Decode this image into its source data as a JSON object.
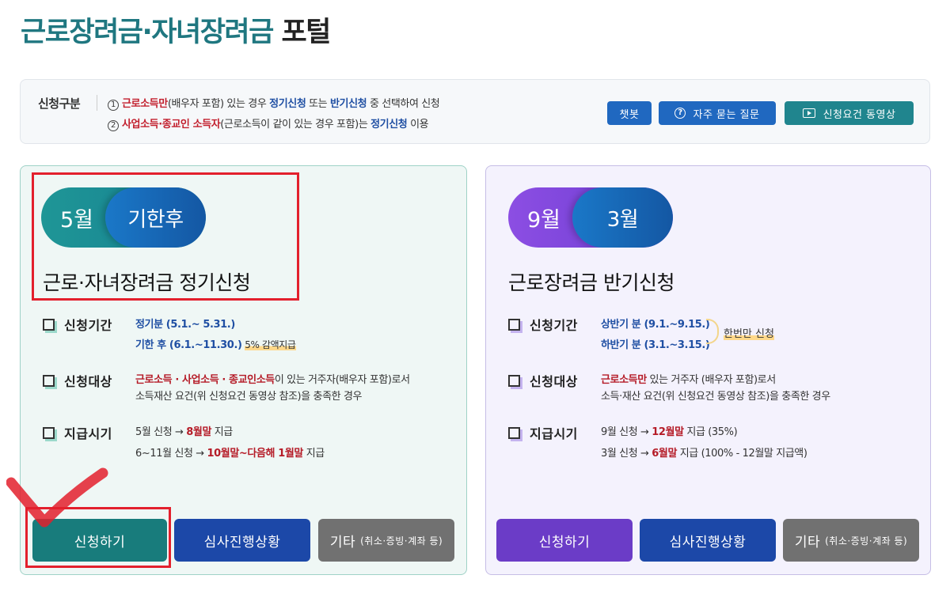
{
  "header": {
    "title_main": "근로장려금·자녀장려금",
    "title_rest": " 포털"
  },
  "info": {
    "label": "신청구분",
    "line1": {
      "num": "1",
      "a": "근로소득만",
      "b": "(배우자 포함) 있는 경우 ",
      "c": "정기신청",
      "d": " 또는 ",
      "e": "반기신청",
      "f": " 중 선택하여 신청"
    },
    "line2": {
      "num": "2",
      "a": "사업소득·종교인 소득자",
      "b": "(근로소득이 같이 있는 경우 포함)는 ",
      "c": "정기신청",
      "d": " 이용"
    },
    "buttons": {
      "chatbot": "챗봇",
      "faq": "자주 묻는 질문",
      "video": "신청요건 동영상"
    }
  },
  "left_card": {
    "pill_a": "5월",
    "pill_b": "기한후",
    "title": "근로·자녀장려금 정기신청",
    "period": {
      "label": "신청기간",
      "l1": "정기분 (5.1.~ 5.31.)",
      "l2": "기한 후 (6.1.~11.30.)",
      "l2_note": "5% 감액지급"
    },
    "target": {
      "label": "신청대상",
      "l1_red": "근로소득 · 사업소득 · 종교인소득",
      "l1_rest": "이 있는 거주자(배우자 포함)로서",
      "l2": "소득재산 요건(위 신청요건 동영상 참조)을 충족한 경우"
    },
    "payment": {
      "label": "지급시기",
      "l1_a": "5월 신청 → ",
      "l1_b": "8월말",
      "l1_c": " 지급",
      "l2_a": "6~11월 신청 → ",
      "l2_b": "10월말~다음해 1월말",
      "l2_c": " 지급"
    },
    "buttons": {
      "apply": "신청하기",
      "status": "심사진행상황",
      "etc": "기타",
      "etc_small": "(취소·증빙·계좌 등)"
    }
  },
  "right_card": {
    "pill_a": "9월",
    "pill_b": "3월",
    "title": "근로장려금 반기신청",
    "period": {
      "label": "신청기간",
      "l1": "상반기 분 (9.1.~9.15.)",
      "l2": "하반기 분 (3.1.~3.15.)",
      "note": "한번만 신청"
    },
    "target": {
      "label": "신청대상",
      "l1_red": "근로소득만",
      "l1_rest": " 있는 거주자 (배우자 포함)로서",
      "l2": "소득·재산 요건(위 신청요건 동영상 참조)을 충족한 경우"
    },
    "payment": {
      "label": "지급시기",
      "l1_a": "9월 신청 → ",
      "l1_b": "12월말",
      "l1_c": " 지급 (35%)",
      "l2_a": "3월 신청 → ",
      "l2_b": "6월말",
      "l2_c": " 지급 (100% - 12월말 지급액)"
    },
    "buttons": {
      "apply": "신청하기",
      "status": "심사진행상황",
      "etc": "기타",
      "etc_small": "(취소·증빙·계좌 등)"
    }
  }
}
